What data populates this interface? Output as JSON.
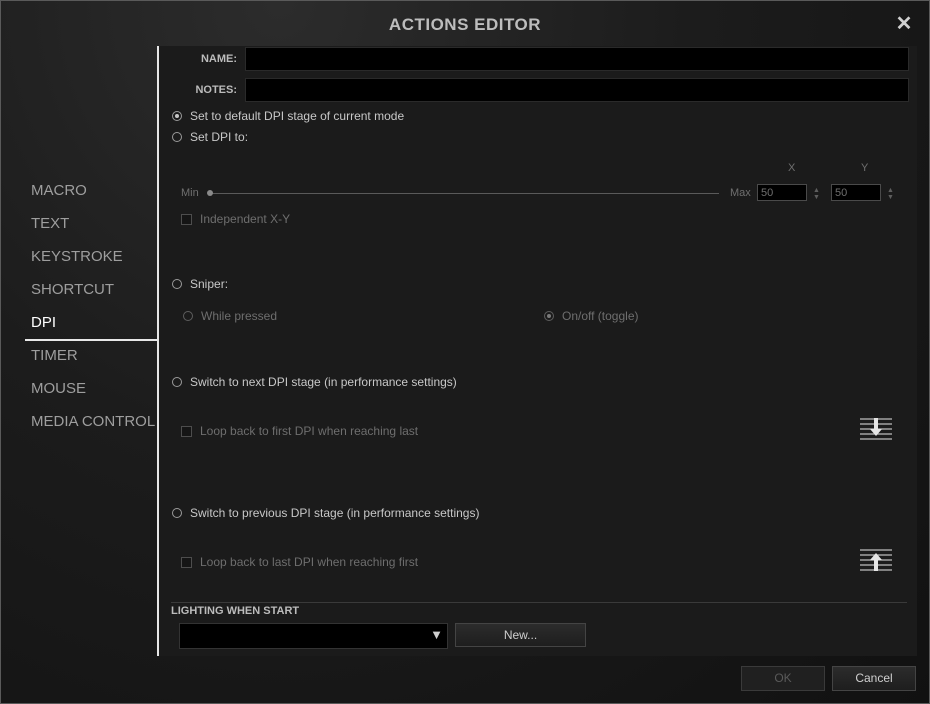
{
  "window": {
    "title": "ACTIONS EDITOR",
    "close_glyph": "✕"
  },
  "sidebar": {
    "items": [
      {
        "label": "MACRO"
      },
      {
        "label": "TEXT"
      },
      {
        "label": "KEYSTROKE"
      },
      {
        "label": "SHORTCUT"
      },
      {
        "label": "DPI",
        "active": true
      },
      {
        "label": "TIMER"
      },
      {
        "label": "MOUSE"
      },
      {
        "label": "MEDIA CONTROL"
      }
    ]
  },
  "form": {
    "name_label": "NAME:",
    "name_value": "",
    "notes_label": "NOTES:",
    "notes_value": ""
  },
  "dpi": {
    "option_default": "Set to default DPI stage of current mode",
    "option_set": "Set DPI to:",
    "x_label": "X",
    "y_label": "Y",
    "min_label": "Min",
    "max_label": "Max",
    "x_value": "50",
    "y_value": "50",
    "independent_xy": "Independent X-Y",
    "option_sniper": "Sniper:",
    "sniper_while_pressed": "While pressed",
    "sniper_toggle": "On/off (toggle)",
    "option_next": "Switch to next DPI stage (in performance settings)",
    "loop_first": "Loop back to first DPI when reaching last",
    "option_prev": "Switch to previous DPI stage (in performance settings)",
    "loop_last": "Loop back to last DPI when reaching first"
  },
  "lighting": {
    "title": "LIGHTING WHEN START",
    "selected": "",
    "new_button": "New..."
  },
  "footer": {
    "ok": "OK",
    "cancel": "Cancel"
  }
}
